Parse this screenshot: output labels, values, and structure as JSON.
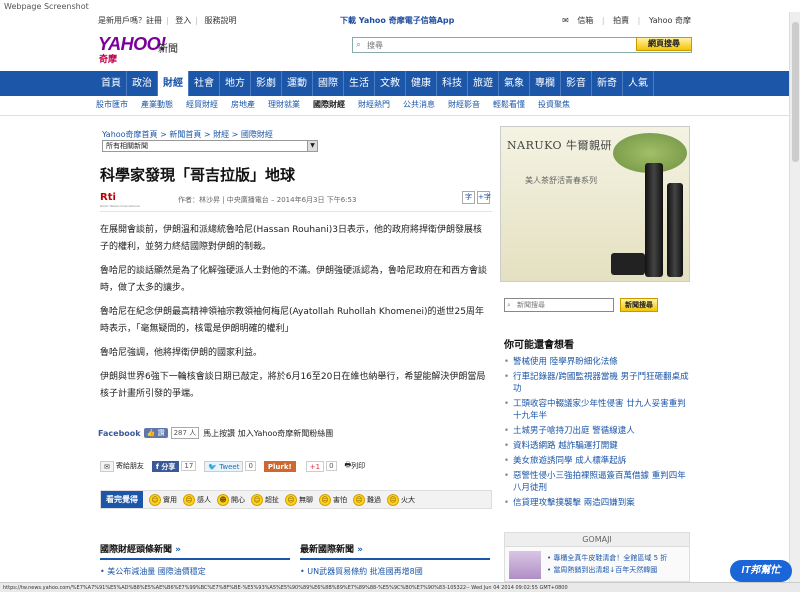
{
  "screenshot_title": "Webpage Screenshot",
  "topbar": {
    "left": [
      "是新用戶嗎？註冊",
      "登入",
      "服務說明"
    ],
    "center": "下載 Yahoo 奇摩電子信箱App",
    "right": [
      "信箱",
      "拍賣",
      "Yahoo 奇摩"
    ]
  },
  "header": {
    "logo_text": "YAHOO!",
    "logo_sub": "奇摩",
    "section": "新聞",
    "search_placeholder": "搜尋",
    "search_button": "網頁搜尋"
  },
  "nav": {
    "items": [
      "首頁",
      "政治",
      "財經",
      "社會",
      "地方",
      "影劇",
      "運動",
      "國際",
      "生活",
      "文教",
      "健康",
      "科技",
      "旅遊",
      "氣象",
      "專欄",
      "影音",
      "新奇",
      "人氣"
    ],
    "active": "財經"
  },
  "subnav": {
    "items": [
      "股市匯市",
      "產業動態",
      "經貿財經",
      "房地產",
      "理財就業",
      "國際財經",
      "財經熱門",
      "公共消息",
      "財經影音",
      "輕鬆看懂",
      "投資聚焦"
    ],
    "active": "國際財經"
  },
  "article": {
    "breadcrumb": "Yahoo奇摩首頁 > 新聞首頁 > 財經 > 國際財經",
    "related_select": "所有相關新聞",
    "title": "科學家發現「哥吉拉版」地球",
    "source_logo": "Rti",
    "source_sub": "Radio Taiwan International",
    "byline": "作者：林沙昇 | 中央廣播電台 – 2014年6月3日 下午6:53",
    "font_buttons": [
      "字",
      "+字"
    ],
    "paragraphs": [
      "在展開會談前，伊朗溫和派總統魯哈尼(Hassan Rouhani)3日表示，他的政府將捍衛伊朗發展核子的權利，並努力終結國際對伊朗的制裁。",
      "魯哈尼的談話顯然是為了化解強硬派人士對他的不滿。伊朗強硬派認為，魯哈尼政府在和西方會談時，做了太多的讓步。",
      "魯哈尼在紀念伊朗最高精神領袖宗教領袖何梅尼(Ayatollah Ruhollah Khomenei)的逝世25周年時表示，「毫無疑問的，核電是伊朗明確的權利」",
      "魯哈尼強調，他將捍衛伊朗的國家利益。",
      "伊朗與世界6強下一輪核會談日期已敲定，將於6月16至20日在維也納舉行，希望能解決伊朗當局核子計畫所引發的爭端。"
    ]
  },
  "facebook": {
    "label": "Facebook",
    "like": "讚",
    "count": "287 人",
    "join": "馬上按讚 加入Yahoo奇摩新聞粉絲團"
  },
  "share": {
    "mail": "寄給朋友",
    "fb_share": "分享",
    "fb_count": "17",
    "tweet": "Tweet",
    "tweet_count": "0",
    "plurk": "Plurk!",
    "g1": "+1",
    "g1_count": "0",
    "print": "列印"
  },
  "mood": {
    "title": "看完覺得",
    "items": [
      "實用",
      "感人",
      "開心",
      "超扯",
      "無聊",
      "害怕",
      "難過",
      "火大"
    ]
  },
  "bottom": {
    "left_title": "國際財經頭條新聞",
    "left_item": "美公布減油量 國際油價穩定",
    "right_title": "最新國際新聞",
    "right_item": "UN武器貿易條約 批准國再增8國"
  },
  "sidebar": {
    "ad_brand": "NARUKO 牛爾親研",
    "ad_tag": "美人茶舒活青春系列",
    "search_placeholder": "新聞搜尋",
    "search_button": "新聞搜尋",
    "interest_title": "你可能還會想看",
    "interest_items": [
      "警械使用 陸學界盼細化法條",
      "行車記錄器/跨國監視器當機 男子鬥狂砸翻桌成功",
      "工頭收容中輟議家少年性侵害 廿九人妥害重判十九年半",
      "土城男子嗆持刀出庭 警循線逮人",
      "資料透網路 越詐騙運打開鍵",
      "美女旅遊誘同學 成人標準起訴",
      "惡警性侵小三強拍裸照逼簽百萬借據 重判四年八月徒刑",
      "信貸理攻擊撲襲擊 兩造四嫌到案"
    ],
    "gomaji_header": "GOMAJI",
    "gomaji_items": [
      "專櫃全真牛皮鞋清倉！全館區域 5 折",
      "當周熱銷到出清超↓百年天然韓國"
    ]
  },
  "status_url": "https://tw.news.yahoo.com/%E7%A7%91%E5%AD%B8%E5%AE%B6%E7%99%BC%E7%8F%BE-%E5%93%A5%E5%90%89%E6%8B%89%E7%89%88-%E5%9C%B0%E7%90%83-105322-- Wed Jun 04 2014 09:02:55 GMT+0800",
  "watermark": "IT邦幫忙"
}
